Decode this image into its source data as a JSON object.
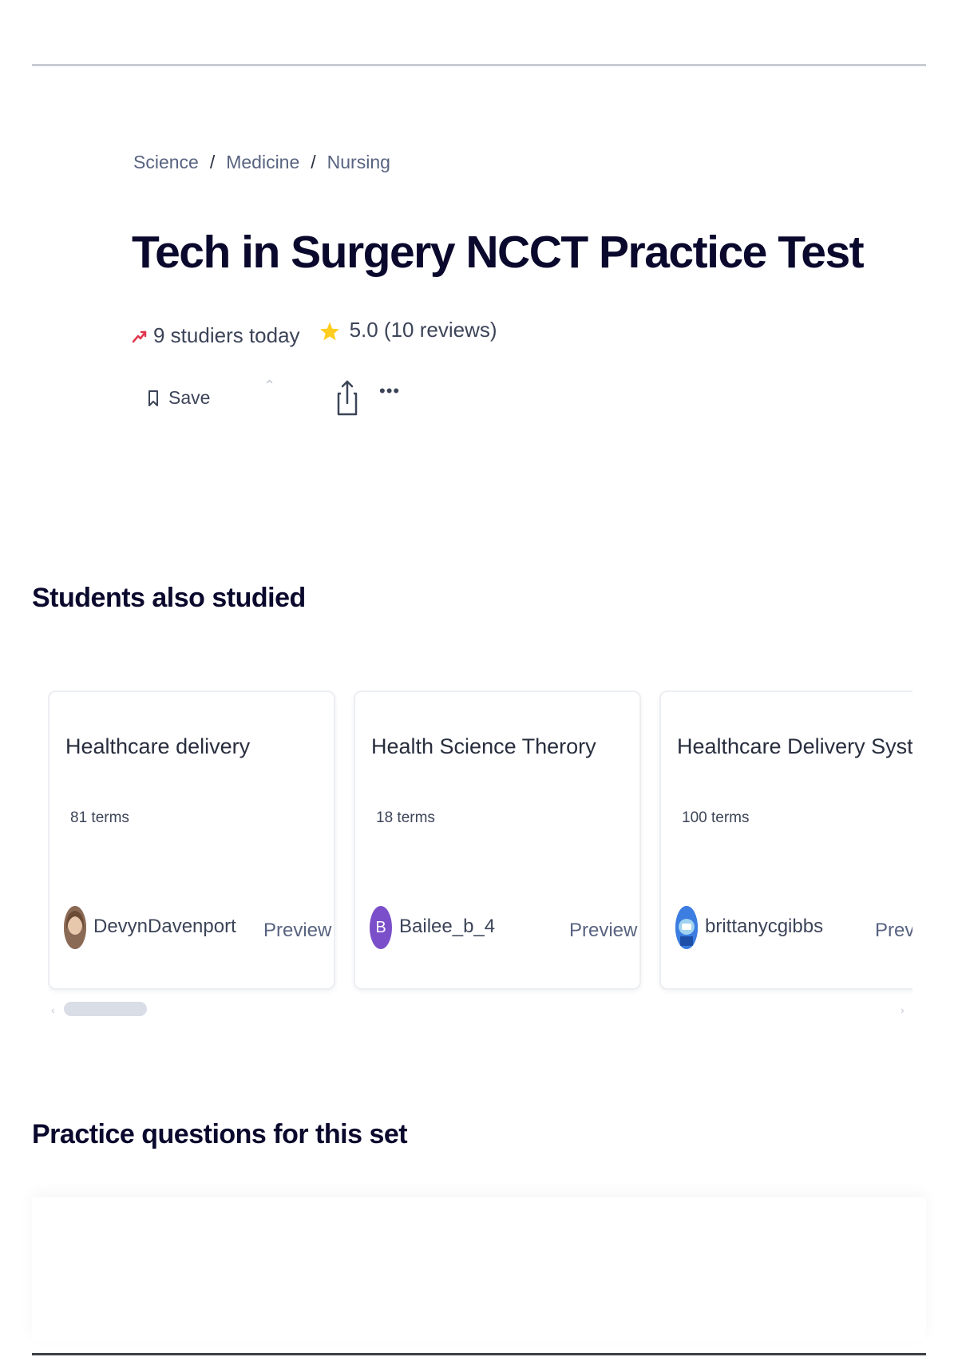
{
  "breadcrumb": [
    "Science",
    "Medicine",
    "Nursing"
  ],
  "title": "Tech in Surgery NCCT Practice Test",
  "stats": {
    "studiers": "9 studiers today",
    "rating": "5.0 (10 reviews)"
  },
  "actions": {
    "save_label": "Save",
    "more_label": "•••"
  },
  "sections": {
    "also_studied": "Students also studied",
    "practice": "Practice questions for this set"
  },
  "cards": [
    {
      "title": "Healthcare delivery",
      "terms": "81 terms",
      "author": "DevynDavenport",
      "avatar_initial": "",
      "avatar_color": "#b08968",
      "preview": "Preview"
    },
    {
      "title": "Health Science Therory",
      "terms": "18 terms",
      "author": "Bailee_b_4",
      "avatar_initial": "B",
      "avatar_color": "#7b4fc9",
      "preview": "Preview"
    },
    {
      "title": "Healthcare Delivery Systems",
      "terms": "100 terms",
      "author": "brittanycgibbs",
      "avatar_initial": "",
      "avatar_color": "#3b7de0",
      "preview": "Preview"
    }
  ],
  "colors": {
    "trend": "#e0364b",
    "star": "#ffcd1f",
    "heading": "#0a092d"
  }
}
